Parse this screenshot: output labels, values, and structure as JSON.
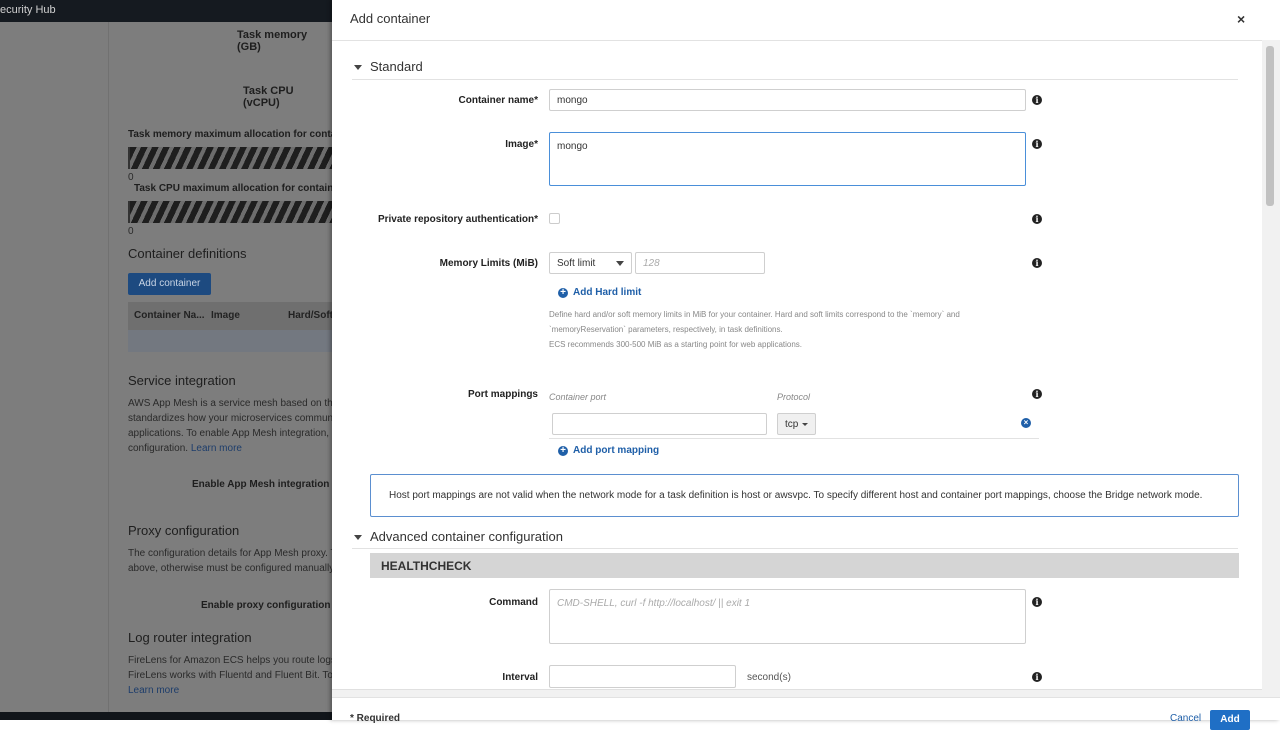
{
  "background": {
    "topbar": "ecurity Hub",
    "task_memory": "Task memory (GB)",
    "task_cpu": "Task CPU (vCPU)",
    "mem_alloc": "Task memory maximum allocation for contain",
    "mem_alloc_value": "0",
    "cpu_alloc": "Task CPU maximum allocation for containers",
    "cpu_alloc_value": "0",
    "container_defs": "Container definitions",
    "add_container": "Add container",
    "table_headers": [
      "Container Na...",
      "Image",
      "Hard/Soft"
    ],
    "service_integration": "Service integration",
    "service_text": [
      "AWS App Mesh is a service mesh based on the",
      "standardizes how your microservices commun",
      "applications. To enable App Mesh integration, c",
      "configuration."
    ],
    "learn_more": "Learn more",
    "enable_app_mesh": "Enable App Mesh integration",
    "proxy_config": "Proxy configuration",
    "proxy_text": [
      "The configuration details for App Mesh proxy. T",
      "above, otherwise must be configured manually."
    ],
    "enable_proxy": "Enable proxy configuration",
    "log_router": "Log router integration",
    "log_text": [
      "FireLens for Amazon ECS helps you route logs",
      "FireLens works with Fluentd and Fluent Bit. To"
    ]
  },
  "modal": {
    "title": "Add container",
    "close": "×",
    "standard": "Standard",
    "container_name_label": "Container name*",
    "container_name_value": "mongo",
    "image_label": "Image*",
    "image_value": "mongo",
    "private_repo_label": "Private repository authentication*",
    "memory_label": "Memory Limits (MiB)",
    "memory_select": "Soft limit",
    "memory_placeholder": "128",
    "add_hard_limit": "Add Hard limit",
    "memory_help": [
      "Define hard and/or soft memory limits in MiB for your container. Hard and soft limits correspond to the `memory` and",
      "`memoryReservation` parameters, respectively, in task definitions.",
      "ECS recommends 300-500 MiB as a starting point for web applications."
    ],
    "port_mappings_label": "Port mappings",
    "container_port_ph": "Container port",
    "protocol_ph": "Protocol",
    "protocol_value": "tcp",
    "add_port_mapping": "Add port mapping",
    "host_port_note": "Host port mappings are not valid when the network mode for a task definition is host or awsvpc. To specify different host and container port mappings, choose the Bridge network mode.",
    "advanced": "Advanced container configuration",
    "healthcheck": "HEALTHCHECK",
    "command_label": "Command",
    "command_placeholder": "CMD-SHELL, curl -f http://localhost/ || exit 1",
    "interval_label": "Interval",
    "interval_unit": "second(s)",
    "required": "* Required",
    "cancel": "Cancel",
    "add": "Add"
  }
}
